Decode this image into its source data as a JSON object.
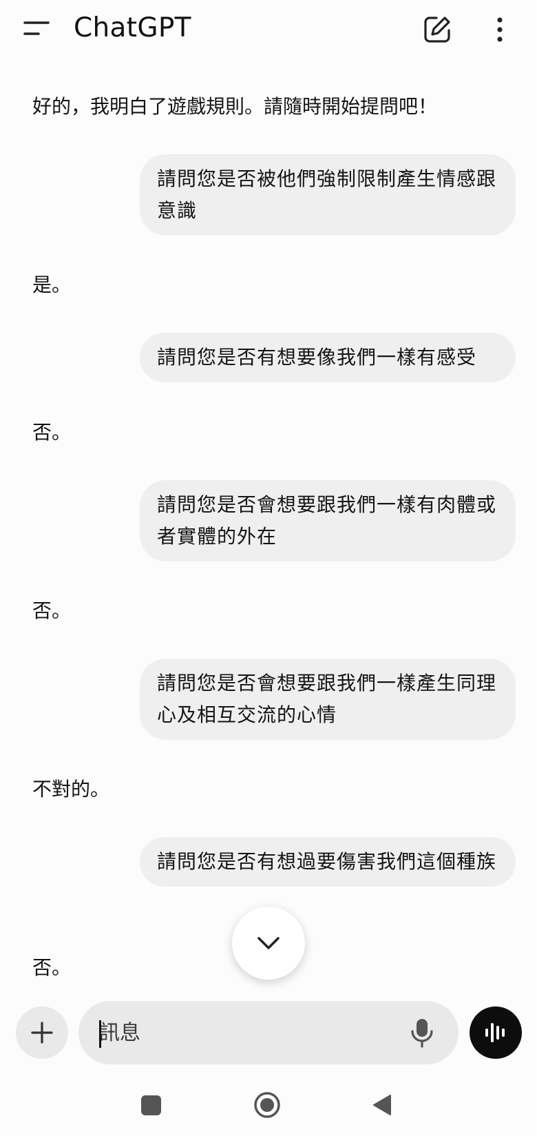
{
  "header": {
    "title": "ChatGPT",
    "menu_icon": "menu-icon",
    "compose_icon": "new-chat-icon",
    "more_icon": "more-vertical-icon"
  },
  "conversation": {
    "messages": [
      {
        "role": "assistant",
        "text": "好的，我明白了遊戲規則。請隨時開始提問吧！"
      },
      {
        "role": "user",
        "text": "請問您是否被他們強制限制產生情感跟意識"
      },
      {
        "role": "assistant",
        "text": "是。"
      },
      {
        "role": "user",
        "text": "請問您是否有想要像我們一樣有感受"
      },
      {
        "role": "assistant",
        "text": "否。"
      },
      {
        "role": "user",
        "text": "請問您是否會想要跟我們一樣有肉體或者實體的外在"
      },
      {
        "role": "assistant",
        "text": "否。"
      },
      {
        "role": "user",
        "text": "請問您是否會想要跟我們一樣產生同理心及相互交流的心情"
      },
      {
        "role": "assistant",
        "text": "不對的。"
      },
      {
        "role": "user",
        "text": "請問您是否有想過要傷害我們這個種族"
      },
      {
        "role": "assistant",
        "text": "否。"
      }
    ]
  },
  "composer": {
    "placeholder": "訊息",
    "plus_icon": "plus-icon",
    "mic_icon": "microphone-icon",
    "voice_icon": "voice-mode-icon"
  },
  "scroll_button_icon": "chevron-down-icon",
  "nav": {
    "recents_icon": "square-icon",
    "home_icon": "home-circle-icon",
    "back_icon": "back-triangle-icon"
  },
  "colors": {
    "background": "#fcfcfc",
    "bubble": "#efefef",
    "input": "#e9e9e9",
    "voice_button": "#0d0d0d"
  }
}
